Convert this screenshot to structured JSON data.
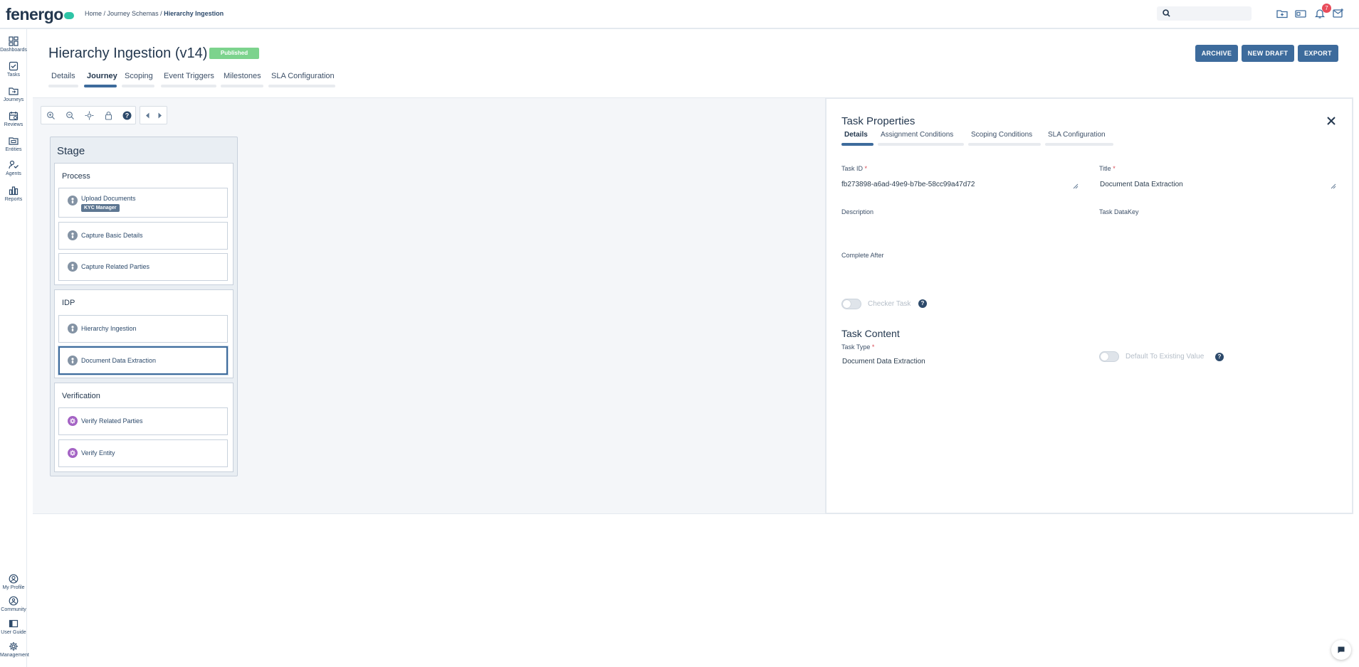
{
  "app": {
    "logo_text": "fenergo",
    "breadcrumb": {
      "home": "Home",
      "sep1": " / ",
      "journey_schemas": "Journey Schemas",
      "sep2": " / ",
      "current": "Hierarchy Ingestion"
    },
    "notification_count": "7"
  },
  "sidebar": {
    "top_items": [
      {
        "label": "Dashboards",
        "icon": "dashboard-icon"
      },
      {
        "label": "Tasks",
        "icon": "tasks-icon"
      },
      {
        "label": "Journeys",
        "icon": "journeys-icon"
      },
      {
        "label": "Reviews",
        "icon": "reviews-icon"
      },
      {
        "label": "Entities",
        "icon": "entities-icon"
      },
      {
        "label": "Agents",
        "icon": "agents-icon"
      },
      {
        "label": "Reports",
        "icon": "reports-icon"
      }
    ],
    "bottom_items": [
      {
        "label": "My Profile",
        "icon": "profile-icon"
      },
      {
        "label": "Community",
        "icon": "community-icon"
      },
      {
        "label": "User Guide",
        "icon": "guide-icon"
      },
      {
        "label": "Management",
        "icon": "gear-icon"
      }
    ]
  },
  "header": {
    "title": "Hierarchy Ingestion (v14)",
    "status_badge": "Published",
    "status_color": "#7cd38d",
    "buttons": {
      "archive": "ARCHIVE",
      "new_draft": "NEW DRAFT",
      "export": "EXPORT"
    },
    "tabs": [
      "Details",
      "Journey",
      "Scoping",
      "Event Triggers",
      "Milestones",
      "SLA Configuration"
    ],
    "active_tab": "Journey"
  },
  "journey": {
    "stage_title": "Stage",
    "groups": [
      {
        "title": "Process",
        "tasks": [
          {
            "label": "Upload Documents",
            "tag": "KYC Manager",
            "icon": "person-icon"
          },
          {
            "label": "Capture Basic Details",
            "icon": "person-icon"
          },
          {
            "label": "Capture Related Parties",
            "icon": "person-icon"
          }
        ]
      },
      {
        "title": "IDP",
        "tasks": [
          {
            "label": "Hierarchy Ingestion",
            "icon": "person-icon"
          },
          {
            "label": "Document Data Extraction",
            "icon": "person-icon",
            "selected": true
          }
        ]
      },
      {
        "title": "Verification",
        "tasks": [
          {
            "label": "Verify Related Parties",
            "icon": "gear-task-icon"
          },
          {
            "label": "Verify Entity",
            "icon": "gear-task-icon"
          }
        ]
      }
    ]
  },
  "task_properties": {
    "title": "Task Properties",
    "tabs": [
      "Details",
      "Assignment Conditions",
      "Scoping Conditions",
      "SLA Configuration"
    ],
    "active_tab": "Details",
    "fields": {
      "task_id_label": "Task ID",
      "task_id_value": "fb273898-a6ad-49e9-b7be-58cc99a47d72",
      "title_label": "Title",
      "title_value": "Document Data Extraction",
      "description_label": "Description",
      "task_datakey_label": "Task DataKey",
      "complete_after_label": "Complete After",
      "checker_task_label": "Checker Task",
      "required_mark": "*"
    },
    "content": {
      "section_title": "Task Content",
      "task_type_label": "Task Type",
      "task_type_value": "Document Data Extraction",
      "default_existing_label": "Default To Existing Value"
    }
  },
  "colors": {
    "accent": "#3d6b9c",
    "navy": "#24384f",
    "brand_green": "#2ec4a6",
    "badge_red": "#e84b5a",
    "gear_purple": "#a463c4"
  }
}
